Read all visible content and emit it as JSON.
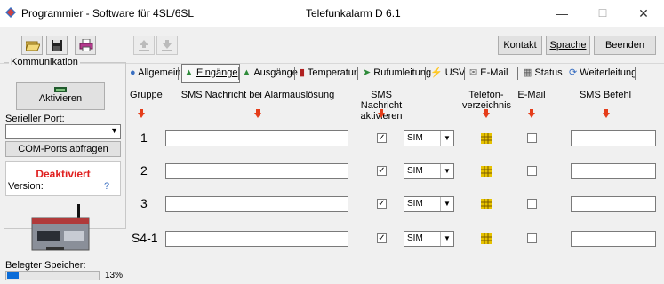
{
  "window": {
    "title": "Programmier - Software für 4SL/6SL",
    "center_title": "Telefunkalarm  D 6.1",
    "minimize": "—",
    "maximize": "☐",
    "close": "✕"
  },
  "toolbar": {
    "kontakt": "Kontakt",
    "sprache": "Sprache",
    "beenden": "Beenden"
  },
  "sidebar": {
    "group_label": "Kommunikation",
    "aktivieren": "Aktivieren",
    "serial_port_label": "Serieller Port:",
    "serial_port_value": "",
    "com_ports_button": "COM-Ports abfragen",
    "status": "Deaktiviert",
    "version_label": "Version:",
    "version_help": "?",
    "memory_label": "Belegter Speicher:",
    "memory_percent": "13%",
    "memory_fraction": 0.13
  },
  "tabs": [
    {
      "label": "Allgemein",
      "icon": "people-icon"
    },
    {
      "label": "Eingänge",
      "icon": "input-icon",
      "active": true
    },
    {
      "label": "Ausgänge",
      "icon": "output-icon"
    },
    {
      "label": "Temperatur",
      "icon": "thermometer-icon"
    },
    {
      "label": "Rufumleitung",
      "icon": "redirect-icon"
    },
    {
      "label": "USV",
      "icon": "lightning-icon"
    },
    {
      "label": "E-Mail",
      "icon": "mail-icon"
    },
    {
      "label": "Status",
      "icon": "status-icon"
    },
    {
      "label": "Weiterleitung",
      "icon": "refresh-icon"
    }
  ],
  "headers": {
    "gruppe": "Gruppe",
    "sms_nachricht": "SMS Nachricht bei Alarmauslösung",
    "sms_aktivieren_1": "SMS Nachricht",
    "sms_aktivieren_2": "aktivieren",
    "telefon_1": "Telefon-",
    "telefon_2": "verzeichnis",
    "email": "E-Mail",
    "sms_befehl": "SMS Befehl"
  },
  "rows": [
    {
      "label": "1",
      "message": "",
      "sms_active": "✓",
      "sim": "SIM",
      "email": "",
      "befehl": ""
    },
    {
      "label": "2",
      "message": "",
      "sms_active": "✓",
      "sim": "SIM",
      "email": "",
      "befehl": ""
    },
    {
      "label": "3",
      "message": "",
      "sms_active": "✓",
      "sim": "SIM",
      "email": "",
      "befehl": ""
    },
    {
      "label": "S4-1",
      "message": "",
      "sms_active": "✓",
      "sim": "SIM",
      "email": "",
      "befehl": ""
    }
  ]
}
